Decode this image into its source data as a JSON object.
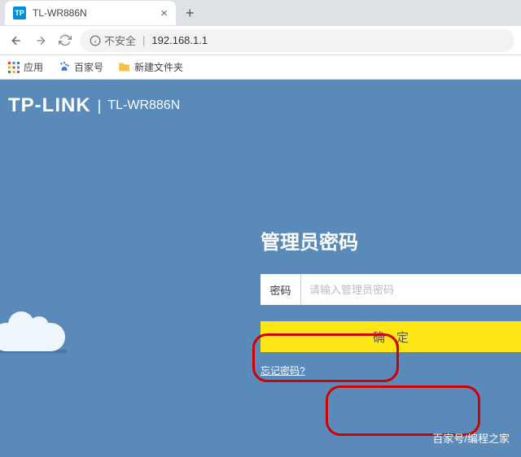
{
  "browser": {
    "tab": {
      "title": "TL-WR886N",
      "favicon": "TP"
    },
    "address": {
      "insecure_label": "不安全",
      "url": "192.168.1.1"
    },
    "bookmarks": {
      "apps": "应用",
      "items": [
        {
          "label": "百家号"
        },
        {
          "label": "新建文件夹"
        }
      ]
    }
  },
  "router": {
    "logo": "TP-LINK",
    "model": "TL-WR886N",
    "login_title": "管理员密码",
    "password_label": "密码",
    "password_placeholder": "请输入管理员密码",
    "submit_label": "确定",
    "forgot_label": "忘记密码?"
  },
  "watermark": "百家号/编程之家"
}
